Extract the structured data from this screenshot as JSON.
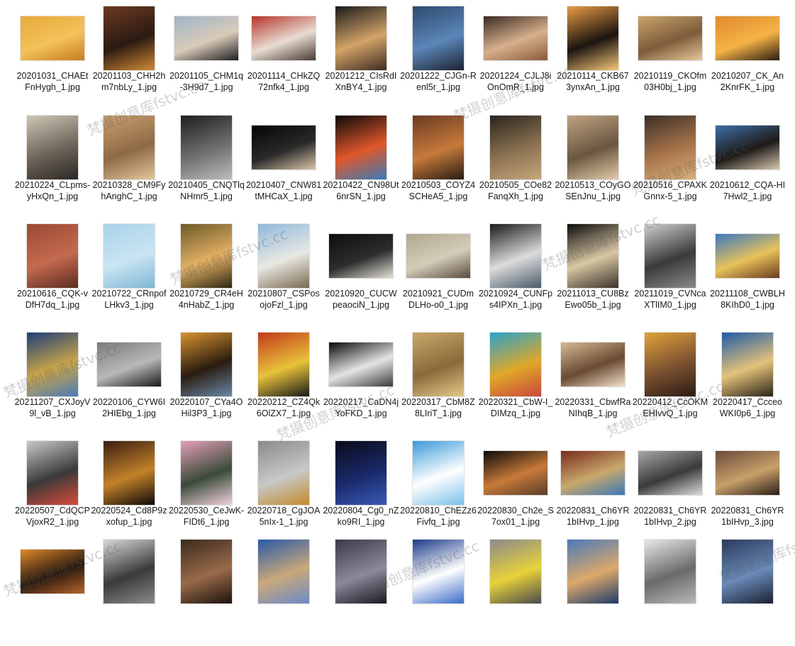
{
  "files": [
    {
      "name": "20201031_CHAEtFnHygh_1.jpg",
      "thumb": {
        "shape": "landscape",
        "colors": [
          "#e8a93a",
          "#f3c25a",
          "#c77c21"
        ]
      }
    },
    {
      "name": "20201103_CHH2hm7nbLy_1.jpg",
      "thumb": {
        "shape": "portrait",
        "colors": [
          "#6b3a1f",
          "#2b1a12",
          "#d08a35"
        ]
      }
    },
    {
      "name": "20201105_CHM1q-3H9d7_1.jpg",
      "thumb": {
        "shape": "landscape",
        "colors": [
          "#9fb4c9",
          "#d9cbb8",
          "#1e1e22"
        ]
      }
    },
    {
      "name": "20201114_CHkZQ72nfk4_1.jpg",
      "thumb": {
        "shape": "landscape",
        "colors": [
          "#b8332a",
          "#e7ddd2",
          "#4a3a33"
        ]
      }
    },
    {
      "name": "20201212_CIsRdIXnBY4_1.jpg",
      "thumb": {
        "shape": "portrait",
        "colors": [
          "#1a1a1a",
          "#d4a469",
          "#3c2c22"
        ]
      }
    },
    {
      "name": "20201222_CJGn-Renl5r_1.jpg",
      "thumb": {
        "shape": "portrait",
        "colors": [
          "#2d4a6e",
          "#5b86b8",
          "#1c2230"
        ]
      }
    },
    {
      "name": "20201224_CJLJ8iOnOmR_1.jpg",
      "thumb": {
        "shape": "landscape",
        "colors": [
          "#3a2a24",
          "#d7b08c",
          "#8a5a3a"
        ]
      }
    },
    {
      "name": "20210114_CKB673ynxAn_1.jpg",
      "thumb": {
        "shape": "portrait",
        "colors": [
          "#e89c45",
          "#1b1410",
          "#f6c779"
        ]
      }
    },
    {
      "name": "20210119_CKOfm03H0bj_1.jpg",
      "thumb": {
        "shape": "landscape",
        "colors": [
          "#c9a46a",
          "#7e5c3a",
          "#e6c99a"
        ]
      }
    },
    {
      "name": "20210207_CK_An2KnrFK_1.jpg",
      "thumb": {
        "shape": "landscape",
        "colors": [
          "#e08a2c",
          "#f5b347",
          "#2a1d12"
        ]
      }
    },
    {
      "name": "20210224_CLpms-yHxQn_1.jpg",
      "thumb": {
        "shape": "portrait",
        "colors": [
          "#cfc6b6",
          "#6e655a",
          "#2b2723"
        ]
      }
    },
    {
      "name": "20210328_CM9FyhAnghC_1.jpg",
      "thumb": {
        "shape": "portrait",
        "colors": [
          "#c8a070",
          "#8e6a45",
          "#e4c79b"
        ]
      }
    },
    {
      "name": "20210405_CNQTlqNHmr5_1.jpg",
      "thumb": {
        "shape": "portrait",
        "colors": [
          "#1e1e1e",
          "#6f6f6f",
          "#bcbcbc"
        ]
      }
    },
    {
      "name": "20210407_CNW81tMHCaX_1.jpg",
      "thumb": {
        "shape": "landscape",
        "colors": [
          "#050505",
          "#2a2a2a",
          "#d9c7a8"
        ]
      }
    },
    {
      "name": "20210422_CN98Ut6nrSN_1.jpg",
      "thumb": {
        "shape": "portrait",
        "colors": [
          "#0a0a0a",
          "#e0572a",
          "#3a7ab8"
        ]
      }
    },
    {
      "name": "20210503_COYZ4SCHeA5_1.jpg",
      "thumb": {
        "shape": "portrait",
        "colors": [
          "#6b3a22",
          "#c67a3b",
          "#2a1a12"
        ]
      }
    },
    {
      "name": "20210505_COe82FanqXh_1.jpg",
      "thumb": {
        "shape": "portrait",
        "colors": [
          "#2a241e",
          "#8c7252",
          "#c6a77a"
        ]
      }
    },
    {
      "name": "20210513_COyGOSEnJnu_1.jpg",
      "thumb": {
        "shape": "portrait",
        "colors": [
          "#bfa482",
          "#6a5640",
          "#e3cca8"
        ]
      }
    },
    {
      "name": "20210516_CPAXKGnnx-5_1.jpg",
      "thumb": {
        "shape": "portrait",
        "colors": [
          "#3b2f28",
          "#a8744a",
          "#d9b07a"
        ]
      }
    },
    {
      "name": "20210612_CQA-HI7Hwl2_1.jpg",
      "thumb": {
        "shape": "landscape",
        "colors": [
          "#3e6fa8",
          "#1e1a18",
          "#d8c9b0"
        ]
      }
    },
    {
      "name": "20210616_CQK-vDfH7dq_1.jpg",
      "thumb": {
        "shape": "portrait",
        "colors": [
          "#9c4a35",
          "#c46a4e",
          "#5a2c20"
        ]
      }
    },
    {
      "name": "20210722_CRnpofLHkv3_1.jpg",
      "thumb": {
        "shape": "portrait",
        "colors": [
          "#a9d3ea",
          "#c9e4f2",
          "#7fb6d6"
        ]
      }
    },
    {
      "name": "20210729_CR4eH4nHabZ_1.jpg",
      "thumb": {
        "shape": "portrait",
        "colors": [
          "#6b5a2a",
          "#e3b063",
          "#2b2613"
        ]
      }
    },
    {
      "name": "20210807_CSPosojoFzl_1.jpg",
      "thumb": {
        "shape": "portrait",
        "colors": [
          "#8fb9dc",
          "#e8e8e2",
          "#7a6a4e"
        ]
      }
    },
    {
      "name": "20210920_CUCWpeaociN_1.jpg",
      "thumb": {
        "shape": "landscape",
        "colors": [
          "#0d0d0d",
          "#2d2d2d",
          "#e6e2d8"
        ]
      }
    },
    {
      "name": "20210921_CUDmDLHo-o0_1.jpg",
      "thumb": {
        "shape": "landscape",
        "colors": [
          "#b0a890",
          "#d4ccb8",
          "#5a4c3e"
        ]
      }
    },
    {
      "name": "20210924_CUNFps4IPXn_1.jpg",
      "thumb": {
        "shape": "portrait",
        "colors": [
          "#1a1a1a",
          "#dcdcdc",
          "#4a5a6a"
        ]
      }
    },
    {
      "name": "20211013_CU8BzEwo05b_1.jpg",
      "thumb": {
        "shape": "portrait",
        "colors": [
          "#0b0b0b",
          "#d9c7a3",
          "#3a3228"
        ]
      }
    },
    {
      "name": "20211019_CVNcaXTlIM0_1.jpg",
      "thumb": {
        "shape": "portrait",
        "colors": [
          "#cfcfcf",
          "#3a3a3a",
          "#8a8a8a"
        ]
      }
    },
    {
      "name": "20211108_CWBLH8KIhD0_1.jpg",
      "thumb": {
        "shape": "landscape",
        "colors": [
          "#3b78c0",
          "#e8c25a",
          "#6a3a22"
        ]
      }
    },
    {
      "name": "20211207_CXJoyV9l_vB_1.jpg",
      "thumb": {
        "shape": "portrait",
        "colors": [
          "#1e3e78",
          "#c9a54a",
          "#4a7ab8"
        ]
      }
    },
    {
      "name": "20220106_CYW6I2HIEbg_1.jpg",
      "thumb": {
        "shape": "landscape",
        "colors": [
          "#7a7a7a",
          "#b8b8b8",
          "#1a1a1a"
        ]
      }
    },
    {
      "name": "20220107_CYa4OHil3P3_1.jpg",
      "thumb": {
        "shape": "portrait",
        "colors": [
          "#d9932f",
          "#2a1c10",
          "#6a88a8"
        ]
      }
    },
    {
      "name": "20220212_CZ4Qk6OlZX7_1.jpg",
      "thumb": {
        "shape": "portrait",
        "colors": [
          "#c23a1a",
          "#e8c23a",
          "#1a1a1a"
        ]
      }
    },
    {
      "name": "20220217_CaDN4jYoFKD_1.jpg",
      "thumb": {
        "shape": "landscape",
        "colors": [
          "#0a0a0a",
          "#e4e4e4",
          "#3a3a3a"
        ]
      }
    },
    {
      "name": "20220317_CbM8Z8LIriT_1.jpg",
      "thumb": {
        "shape": "portrait",
        "colors": [
          "#c8a86a",
          "#8a6a3a",
          "#e3c88a"
        ]
      }
    },
    {
      "name": "20220321_CbW-I_DIMzq_1.jpg",
      "thumb": {
        "shape": "portrait",
        "colors": [
          "#2aa3c8",
          "#e0a82a",
          "#c8463a"
        ]
      }
    },
    {
      "name": "20220331_CbwfRaNIhqB_1.jpg",
      "thumb": {
        "shape": "landscape",
        "colors": [
          "#d8b994",
          "#6a4a32",
          "#f2e2cc"
        ]
      }
    },
    {
      "name": "20220412_CcOKMEHIvvQ_1.jpg",
      "thumb": {
        "shape": "portrait",
        "colors": [
          "#e0a23a",
          "#7a5030",
          "#2a1c12"
        ]
      }
    },
    {
      "name": "20220417_CcceoWKI0p6_1.jpg",
      "thumb": {
        "shape": "portrait",
        "colors": [
          "#1e5aa8",
          "#e4c27a",
          "#2a2418"
        ]
      }
    },
    {
      "name": "20220507_CdQCPVjoxR2_1.jpg",
      "thumb": {
        "shape": "portrait",
        "colors": [
          "#c8c8c8",
          "#3a3a3a",
          "#d94a3a"
        ]
      }
    },
    {
      "name": "20220524_Cd8P9zxofup_1.jpg",
      "thumb": {
        "shape": "portrait",
        "colors": [
          "#3a1e12",
          "#c2822a",
          "#0e0a08"
        ]
      }
    },
    {
      "name": "20220530_CeJwK-FIDt6_1.jpg",
      "thumb": {
        "shape": "portrait",
        "colors": [
          "#e4a0b8",
          "#3a4a3a",
          "#f2d2dc"
        ]
      }
    },
    {
      "name": "20220718_CgJOA5nIx-1_1.jpg",
      "thumb": {
        "shape": "portrait",
        "colors": [
          "#8a8a8a",
          "#c8c8c8",
          "#c28a2a"
        ]
      }
    },
    {
      "name": "20220804_Cg0_nZko9RI_1.jpg",
      "thumb": {
        "shape": "portrait",
        "colors": [
          "#0a0a1a",
          "#1a2a6a",
          "#3a5ab8"
        ]
      }
    },
    {
      "name": "20220810_ChEZz6Fivfq_1.jpg",
      "thumb": {
        "shape": "portrait",
        "colors": [
          "#3a9ad8",
          "#ffffff",
          "#7ac0ea"
        ]
      }
    },
    {
      "name": "20220830_Ch2e_S7ox01_1.jpg",
      "thumb": {
        "shape": "landscape",
        "colors": [
          "#0a0a0a",
          "#c87a3a",
          "#5a3a2a"
        ]
      }
    },
    {
      "name": "20220831_Ch6YR1bIHvp_1.jpg",
      "thumb": {
        "shape": "landscape",
        "colors": [
          "#7a2a1e",
          "#c8a86a",
          "#3a78b8"
        ]
      }
    },
    {
      "name": "20220831_Ch6YR1bIHvp_2.jpg",
      "thumb": {
        "shape": "landscape",
        "colors": [
          "#a8a8a8",
          "#3a3a3a",
          "#dcdcdc"
        ]
      }
    },
    {
      "name": "20220831_Ch6YR1bIHvp_3.jpg",
      "thumb": {
        "shape": "landscape",
        "colors": [
          "#6a4a3a",
          "#c8a06a",
          "#2a1e16"
        ]
      }
    },
    {
      "name": "",
      "thumb": {
        "shape": "landscape",
        "colors": [
          "#e08a2a",
          "#2a1a10",
          "#b8642a"
        ]
      }
    },
    {
      "name": "",
      "thumb": {
        "shape": "portrait",
        "colors": [
          "#d8d8d8",
          "#3a3a3a",
          "#8a8a8a"
        ]
      }
    },
    {
      "name": "",
      "thumb": {
        "shape": "portrait",
        "colors": [
          "#3a2a1e",
          "#9a6a4a",
          "#1a120c"
        ]
      }
    },
    {
      "name": "",
      "thumb": {
        "shape": "portrait",
        "colors": [
          "#2a5aa8",
          "#c8a87a",
          "#6a8ac8"
        ]
      }
    },
    {
      "name": "",
      "thumb": {
        "shape": "portrait",
        "colors": [
          "#3a3a4a",
          "#8a8a9a",
          "#1a1a22"
        ]
      }
    },
    {
      "name": "",
      "thumb": {
        "shape": "portrait",
        "colors": [
          "#1a3a8a",
          "#ffffff",
          "#3a6ac8"
        ]
      }
    },
    {
      "name": "",
      "thumb": {
        "shape": "portrait",
        "colors": [
          "#8a8a8a",
          "#e8d23a",
          "#4a4a4a"
        ]
      }
    },
    {
      "name": "",
      "thumb": {
        "shape": "portrait",
        "colors": [
          "#4a7ab8",
          "#dca86a",
          "#1e3a6a"
        ]
      }
    },
    {
      "name": "",
      "thumb": {
        "shape": "portrait",
        "colors": [
          "#e8e8e8",
          "#6a6a6a",
          "#b8b8b8"
        ]
      }
    },
    {
      "name": "",
      "thumb": {
        "shape": "portrait",
        "colors": [
          "#2a3a5a",
          "#6a8ab8",
          "#1a2232"
        ]
      }
    }
  ],
  "watermarks": [
    {
      "text": "梵摄创意库fstvc.cc"
    },
    {
      "text": "梵摄创意库fstvc.cc"
    },
    {
      "text": "梵摄创意库fstvc.cc"
    },
    {
      "text": "梵摄创意库fstvc.cc"
    },
    {
      "text": "梵摄创意库fstvc.cc"
    },
    {
      "text": "梵摄创意库fstvc.cc"
    },
    {
      "text": "梵摄创意库fstvc.cc"
    },
    {
      "text": "梵摄创意库fstvc.cc"
    },
    {
      "text": "梵摄创意库fstvc.cc"
    },
    {
      "text": "梵摄创意库fstvc.cc"
    },
    {
      "text": "梵摄创意库fstvc.cc"
    }
  ]
}
